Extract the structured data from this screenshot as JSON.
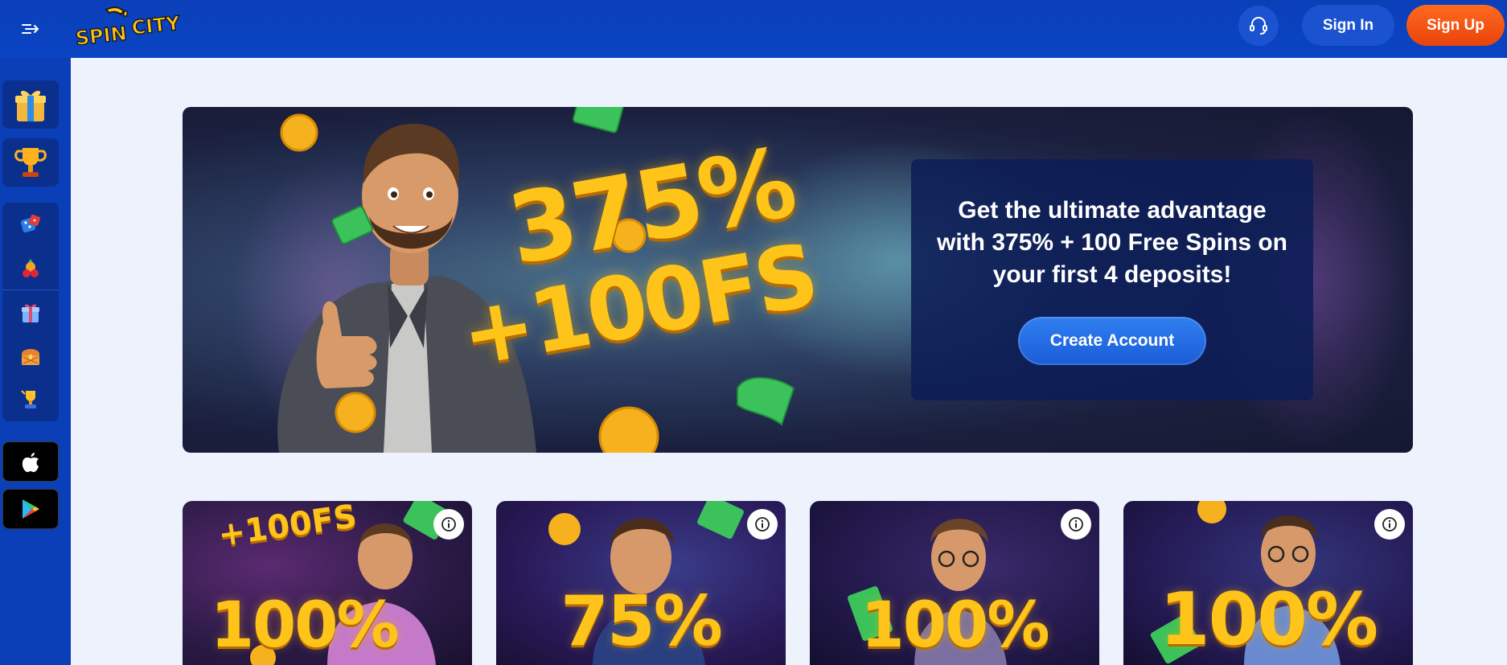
{
  "header": {
    "logo_text": "SPIN CITY",
    "signin_label": "Sign In",
    "signup_label": "Sign Up"
  },
  "hero": {
    "headline": "375%",
    "subheadline": "+100FS",
    "promo_text": "Get the ultimate advantage with 375% + 100 Free Spins on your first 4 deposits!",
    "cta_label": "Create Account"
  },
  "cards": [
    {
      "top_text": "+100FS",
      "percent": "100%"
    },
    {
      "top_text": "",
      "percent": "75%"
    },
    {
      "top_text": "",
      "percent": "100%"
    },
    {
      "top_text": "",
      "percent": "100%"
    }
  ],
  "colors": {
    "brand_blue": "#0a44c4",
    "signup_orange": "#f2541a",
    "cta_blue": "#2369e3",
    "gold": "#ffc419"
  }
}
